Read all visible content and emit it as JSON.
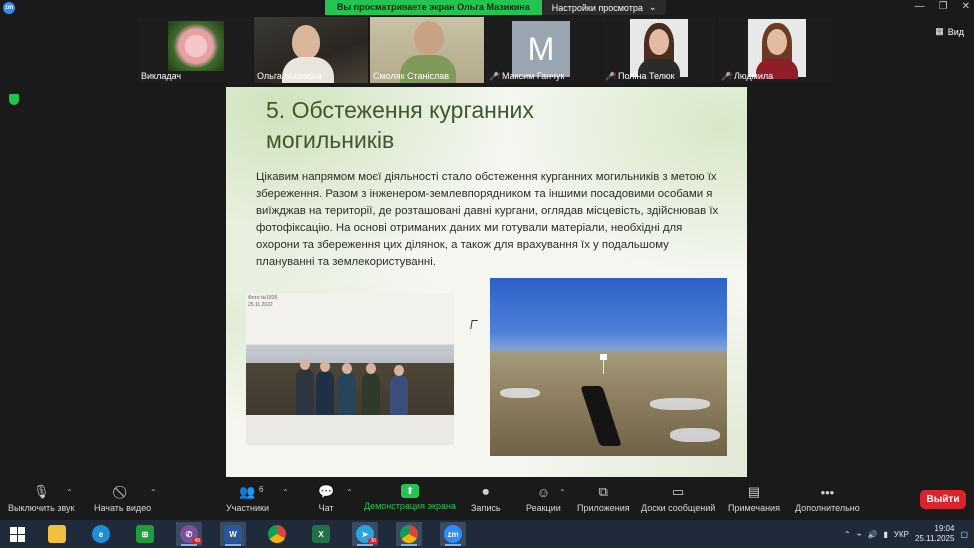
{
  "titlebar": {
    "zoom_logo": "zm",
    "share_banner": "Вы просматриваете экран Ольга Мазикина",
    "view_settings": "Настройки просмотра",
    "view_settings_caret": "⌄"
  },
  "participants": [
    {
      "name": "Викладач",
      "muted": false
    },
    {
      "name": "Ольга Мазикіна",
      "muted": false
    },
    {
      "name": "Смоляк Станіслав",
      "muted": false,
      "active": true
    },
    {
      "name": "Максим Ганчук",
      "muted": true,
      "avatar_letter": "M"
    },
    {
      "name": "Поліна Телюк",
      "muted": true
    },
    {
      "name": "Людмила",
      "muted": true
    }
  ],
  "view_button": "Вид",
  "slide": {
    "title": "5. Обстеження курганних могильників",
    "body": "Цікавим напрямом моєї діяльності стало обстеження курганних могильників з метою їх збереження. Разом з інженером-землевпорядником та іншими посадовими особами я виїжджав на території, де розташовані давні кургани, оглядав місцевість, здійснював їх фотофіксацію. На основі отриманих даних ми готували матеріали, необхідні для охорони та збереження цих ділянок, а також для врахування їх у подальшому плануванні та землекористуванні.",
    "photo_caption_line1": "Фото №1836",
    "photo_caption_line2": "25.11.2022"
  },
  "controls": {
    "mute": "Выключить звук",
    "video": "Начать видео",
    "participants": "Участники",
    "participants_count": "6",
    "chat": "Чат",
    "share": "Демонстрация экрана",
    "record": "Запись",
    "reactions": "Реакции",
    "apps": "Приложения",
    "whiteboard": "Доски сообщений",
    "notes": "Примечания",
    "more": "Дополнительно",
    "leave": "Выйти"
  },
  "taskbar": {
    "viber_badge": "49",
    "telegram_badge": "36",
    "language": "УКР",
    "time": "19:04",
    "date": "25.11.2025"
  },
  "colors": {
    "share_green": "#23c552",
    "leave_red": "#d9232d",
    "slide_title": "#3d5a2c"
  }
}
